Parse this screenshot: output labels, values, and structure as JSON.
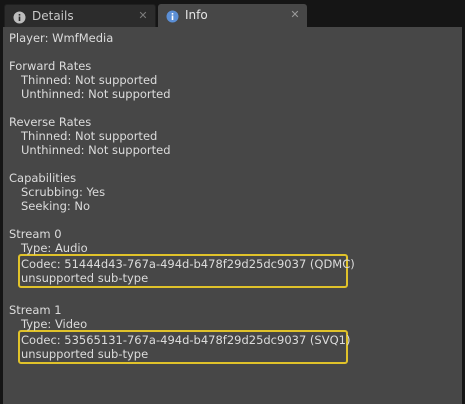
{
  "tabs": [
    {
      "label": "Details",
      "icon": "info-icon",
      "active": false
    },
    {
      "label": "Info",
      "icon": "info-icon",
      "active": true
    }
  ],
  "close_glyph": "✕",
  "info": {
    "player": "Player: WmfMedia",
    "forward": {
      "heading": "Forward Rates",
      "thinned": "Thinned: Not supported",
      "unthinned": "Unthinned: Not supported"
    },
    "reverse": {
      "heading": "Reverse Rates",
      "thinned": "Thinned: Not supported",
      "unthinned": "Unthinned: Not supported"
    },
    "capabilities": {
      "heading": "Capabilities",
      "scrubbing": "Scrubbing: Yes",
      "seeking": "Seeking: No"
    },
    "streams": [
      {
        "heading": "Stream 0",
        "type": "Type: Audio",
        "codec": "Codec: 51444d43-767a-494d-b478f29d25dc9037 (QDMC)",
        "subtype": "unsupported sub-type"
      },
      {
        "heading": "Stream 1",
        "type": "Type: Video",
        "codec": "Codec: 53565131-767a-494d-b478f29d25dc9037 (SVQ1)",
        "subtype": "unsupported sub-type"
      }
    ]
  },
  "colors": {
    "highlight_border": "#e0c22a",
    "panel_bg": "#474747",
    "tab_icon": "#5b8fd6"
  }
}
